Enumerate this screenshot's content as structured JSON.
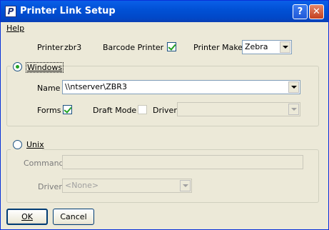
{
  "window": {
    "title": "Printer Link Setup",
    "icon_letter": "P",
    "help_glyph": "?",
    "close_glyph": "✕"
  },
  "menu": {
    "help": "Help"
  },
  "printer": {
    "label": "Printer",
    "value": "zbr3",
    "barcode_label": "Barcode Printer",
    "barcode_checked": true,
    "make_label": "Printer Make",
    "make_value": "Zebra"
  },
  "windows_group": {
    "label": "Windows",
    "selected": true,
    "name_label": "Name",
    "name_value": "\\\\ntserver\\ZBR3",
    "forms_label": "Forms",
    "forms_checked": true,
    "draft_label": "Draft Mode",
    "draft_checked": false,
    "driver_label": "Driver",
    "driver_value": ""
  },
  "unix_group": {
    "label": "Unix",
    "selected": false,
    "command_label": "Command",
    "command_value": "",
    "driver_label": "Driver",
    "driver_value": "<None>"
  },
  "buttons": {
    "ok": "OK",
    "cancel": "Cancel"
  },
  "colors": {
    "titlebar": "#0151d6",
    "face": "#ece9d8",
    "checkmark": "#21a121"
  }
}
